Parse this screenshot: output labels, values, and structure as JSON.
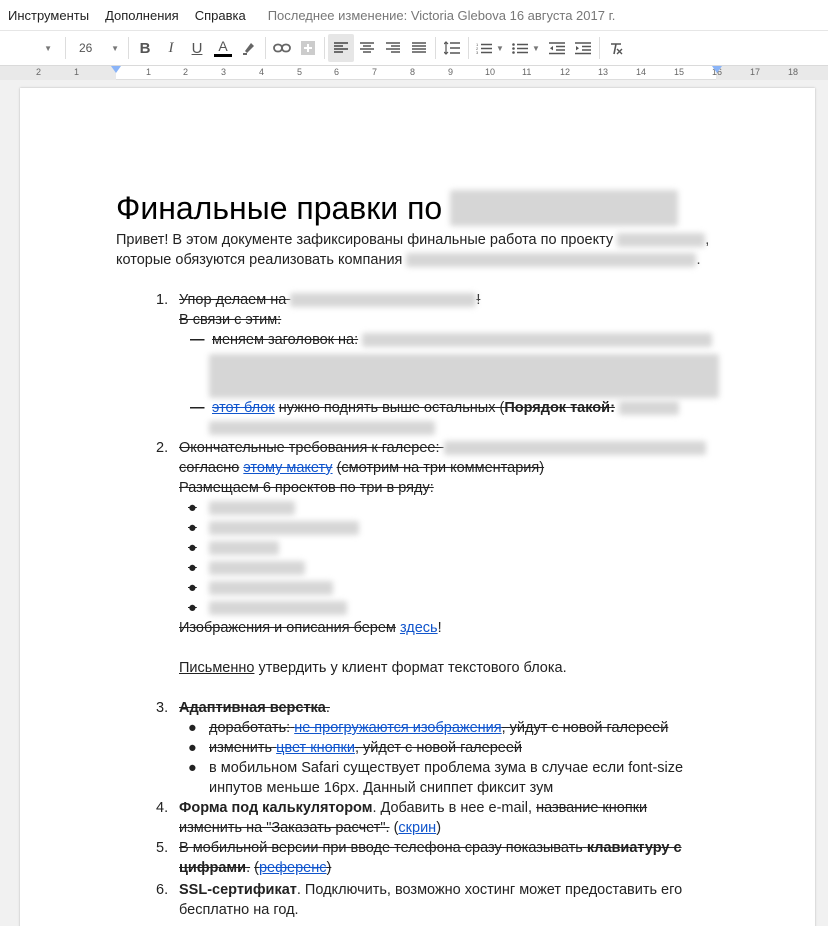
{
  "menu": {
    "items": [
      "Инструменты",
      "Дополнения",
      "Справка"
    ],
    "last_edit": "Последнее изменение: Victoria Glebova 16 августа 2017 г."
  },
  "toolbar": {
    "font_size": "26",
    "icons": [
      "bold-icon",
      "italic-icon",
      "underline-icon",
      "text-color-icon",
      "highlight-icon",
      "link-icon",
      "comment-icon",
      "align-left-icon",
      "align-center-icon",
      "align-right-icon",
      "align-justify-icon",
      "line-spacing-icon",
      "numbered-list-icon",
      "bulleted-list-icon",
      "decrease-indent-icon",
      "increase-indent-icon",
      "clear-formatting-icon"
    ],
    "text_color_underline": "#000000"
  },
  "ruler": {
    "numbers": [
      "2",
      "1",
      "1",
      "2",
      "3",
      "4",
      "5",
      "6",
      "7",
      "8",
      "9",
      "10",
      "11",
      "12",
      "13",
      "14",
      "15",
      "16",
      "17",
      "18"
    ]
  },
  "doc": {
    "title": "Финальные правки по",
    "intro_1": "Привет! В этом документе зафиксированы финальные работа по проекту",
    "intro_1_end": ",",
    "intro_2": "которые обязуются реализовать компания",
    "intro_2_end": ".",
    "item1": {
      "num": "1.",
      "text": "Упор делаем на",
      "end": "!",
      "sub": "В связи с этим:",
      "b1_text": "меняем заголовок на:",
      "b2_link": "этот блок",
      "b2_text": "нужно поднять выше остальных (",
      "b2_bold": "Порядок такой:"
    },
    "item2": {
      "num": "2.",
      "text": "Окончательные требования к галерее:",
      "line2_pre": "согласно",
      "line2_link": "этому макету",
      "line2_post": "(смотрим на три комментария)",
      "line3": "Размещаем 6 проектов по три в ряду:",
      "line4_pre": "Изображения и описания берем",
      "line4_link": "здесь",
      "line4_end": "!",
      "line5_u": "Письменно",
      "line5_text": "утвердить у клиент формат текстового блока."
    },
    "item3": {
      "num": "3.",
      "title": "Адаптивная верстка",
      "title_end": ".",
      "b1_pre": "доработать:",
      "b1_link": "не прогружаются изображения",
      "b1_post": ", уйдут с новой галереей",
      "b2_pre": "изменить",
      "b2_link": "цвет кнопки",
      "b2_post": ", уйдет с новой галереей",
      "b3_line1": "в мобильном Safari существует проблема зума в случае если font-size",
      "b3_line2": "инпутов меньше 16px. Данный сниппет фиксит зум"
    },
    "item4": {
      "num": "4.",
      "bold": "Форма под калькулятором",
      "text": ". Добавить в нее e-mail,",
      "strike1": "название кнопки",
      "strike2": "изменить на \"Заказать расчет\".",
      "link_pre": "(",
      "link": "скрин",
      "link_post": ")"
    },
    "item5": {
      "num": "5.",
      "text": "В мобильной версии при вводе телефона сразу показывать",
      "bold1": "клавиатуру с",
      "bold2": "цифрами",
      "text2": ".",
      "link_pre": "(",
      "link": "референс",
      "link_post": ")"
    },
    "item6": {
      "num": "6.",
      "bold": "SSL-сертификат",
      "text": ". Подключить, возможно хостинг может предоставить его",
      "line2": "бесплатно на год."
    },
    "bullet_glyph": "●"
  }
}
